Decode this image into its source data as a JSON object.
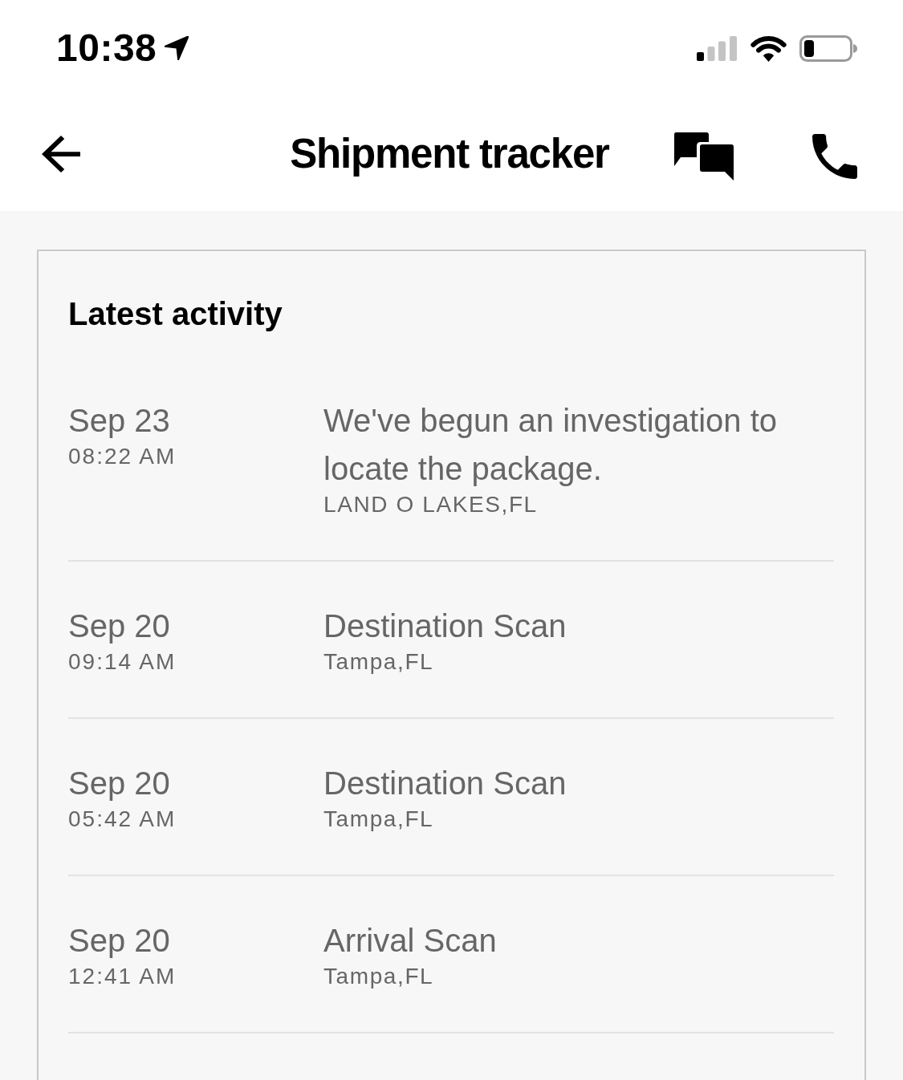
{
  "status_bar": {
    "time": "10:38"
  },
  "nav_bar": {
    "title": "Shipment tracker"
  },
  "activity": {
    "heading": "Latest activity",
    "events": [
      {
        "date": "Sep 23",
        "time": "08:22 AM",
        "description": "We've begun an investigation to locate the package.",
        "location": "LAND O LAKES,FL"
      },
      {
        "date": "Sep 20",
        "time": "09:14 AM",
        "description": "Destination Scan",
        "location": "Tampa,FL"
      },
      {
        "date": "Sep 20",
        "time": "05:42 AM",
        "description": "Destination Scan",
        "location": "Tampa,FL"
      },
      {
        "date": "Sep 20",
        "time": "12:41 AM",
        "description": "Arrival Scan",
        "location": "Tampa,FL"
      }
    ]
  }
}
